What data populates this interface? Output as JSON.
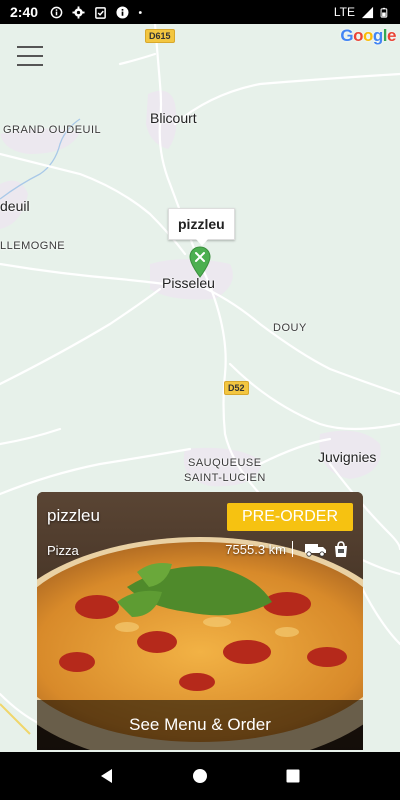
{
  "status_bar": {
    "time": "2:40",
    "network": "LTE",
    "icons": [
      "info-circle-icon",
      "settings-gear-icon",
      "clipboard-check-icon",
      "info-filled-icon",
      "dot-icon"
    ],
    "right_icons": [
      "wifi-signal-icon",
      "battery-icon"
    ]
  },
  "map": {
    "logo": "Google",
    "places": {
      "blicourt": "Blicourt",
      "grand_oudeuil": "GRAND OUDEUIL",
      "oudeuil": "deuil",
      "lemogne": "LLEMOGNE",
      "pisseleu": "Pisseleu",
      "douy": "DOUY",
      "sauqueuse": "SAUQUEUSE",
      "saint_lucien": "SAINT-LUCIEN",
      "juvignies": "Juvignies"
    },
    "roads": {
      "d615": "D615",
      "d52": "D52"
    },
    "marker_label": "pizzleu"
  },
  "card": {
    "name": "pizzleu",
    "preorder_label": "PRE-ORDER",
    "category": "Pizza",
    "distance": "7555.3 km",
    "cta": "See Menu & Order",
    "icons": [
      "delivery-truck-icon",
      "takeaway-bag-icon"
    ]
  },
  "colors": {
    "map_bg": "#e7f1ea",
    "accent": "#f6c211",
    "marker": "#4caf50"
  }
}
